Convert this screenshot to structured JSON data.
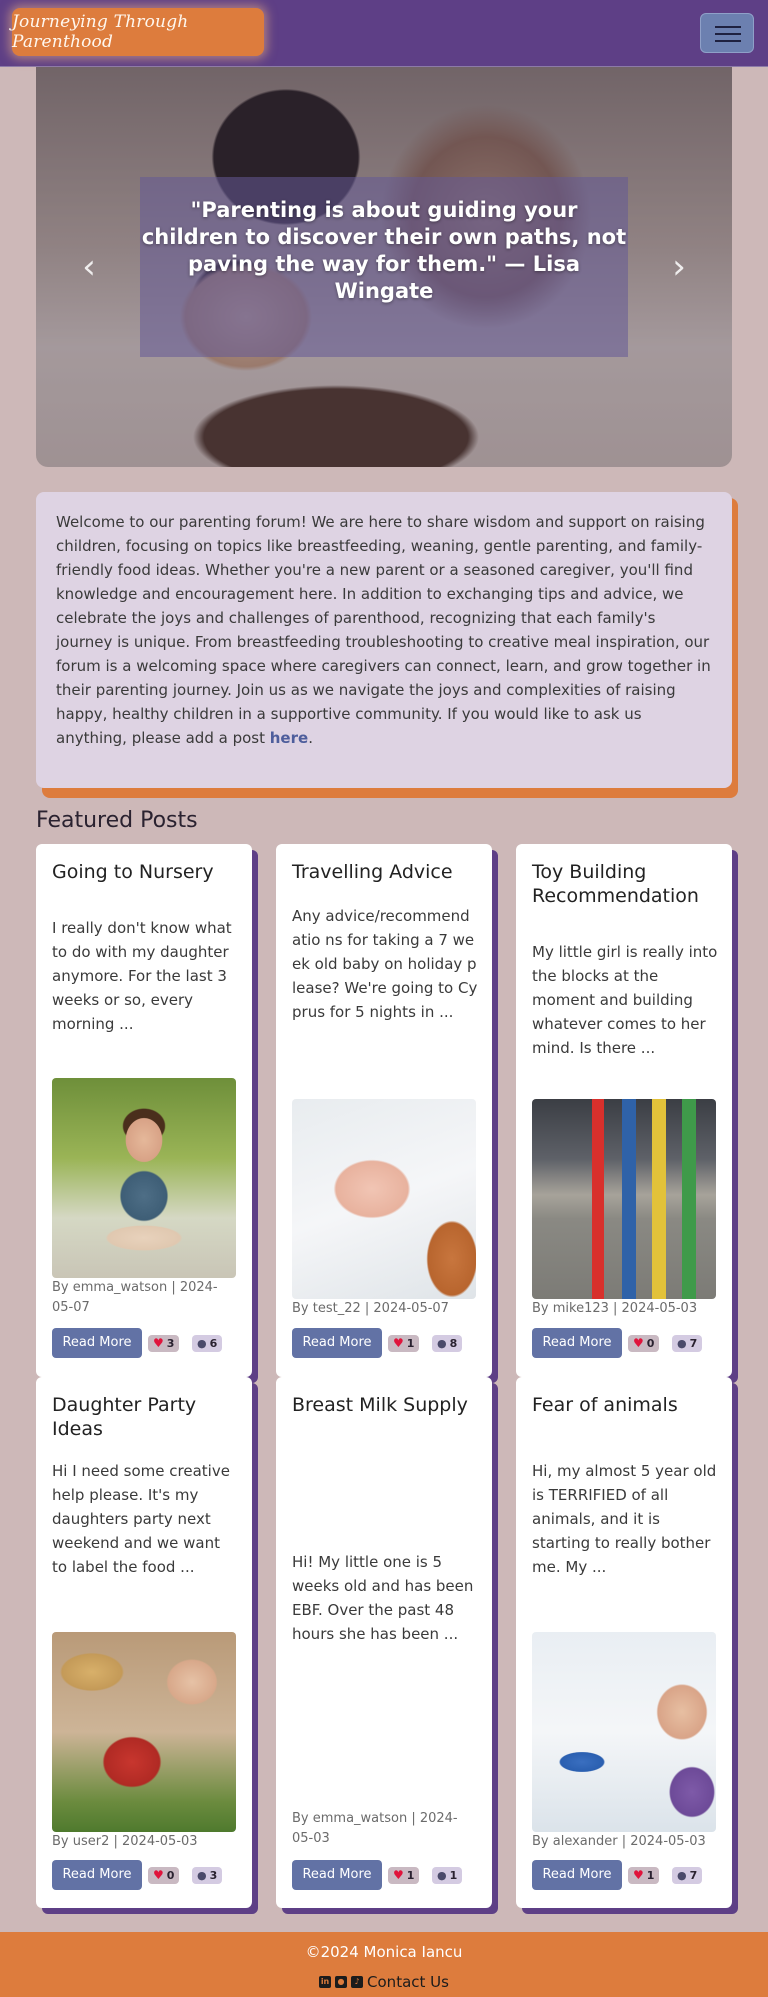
{
  "navbar": {
    "brand": "Journeying Through Parenthood",
    "toggler_icon": "hamburger-menu-icon"
  },
  "hero": {
    "quote": "\"Parenting is about guiding your children to discover their own paths, not paving the way for them.\" — Lisa Wingate",
    "prev_icon": "chevron-left-icon",
    "next_icon": "chevron-right-icon"
  },
  "welcome": {
    "text": "Welcome to our parenting forum! We are here to share wisdom and support on raising children, focusing on topics like breastfeeding, weaning, gentle parenting, and family-friendly food ideas. Whether you're a new parent or a seasoned caregiver, you'll find knowledge and encouragement here. In addition to exchanging tips and advice, we celebrate the joys and challenges of parenthood, recognizing that each family's journey is unique. From breastfeeding troubleshooting to creative meal inspiration, our forum is a welcoming space where caregivers can connect, learn, and grow together in their parenting journey. Join us as we navigate the joys and complexities of raising happy, healthy children in a supportive community. If you would like to ask us anything, please add a post ",
    "link_text": "here",
    "end": "."
  },
  "featured": {
    "title": "Featured Posts",
    "read_more_label": "Read More",
    "posts": [
      {
        "title": "Going to Nursery",
        "excerpt": "I really don't know what to do with my daughter anymore. For the last 3 weeks or so, every morning ...",
        "meta": "By emma_watson | 2024-05-07",
        "likes": "3",
        "comments": "6"
      },
      {
        "title": "Travelling Advice",
        "excerpt": "Any advice/recommendatio ns for taking a 7 week old baby on holiday please? We're going to Cyprus for 5 nights in ...",
        "meta": "By test_22 | 2024-05-07",
        "likes": "1",
        "comments": "8"
      },
      {
        "title": "Toy Building Recommendation",
        "excerpt": "My little girl is really into the blocks at the moment and building whatever comes to her mind. Is there ...",
        "meta": "By mike123 | 2024-05-03",
        "likes": "0",
        "comments": "7"
      },
      {
        "title": "Daughter Party Ideas",
        "excerpt": "Hi I need some creative help please. It's my daughters party next weekend and we want to label the food ...",
        "meta": "By user2 | 2024-05-03",
        "likes": "0",
        "comments": "3"
      },
      {
        "title": "Breast Milk Supply",
        "excerpt": "Hi! My little one is 5 weeks old and has been EBF. Over the past 48 hours she has been ...",
        "meta": "By emma_watson | 2024-05-03",
        "likes": "1",
        "comments": "1"
      },
      {
        "title": "Fear of animals",
        "excerpt": "Hi, my almost 5 year old is TERRIFIED of all animals, and it is starting to really bother me. My ...",
        "meta": "By alexander | 2024-05-03",
        "likes": "1",
        "comments": "7"
      }
    ]
  },
  "footer": {
    "copyright": "©2024 Monica Iancu",
    "contact": "Contact Us",
    "icons": [
      "linkedin-icon",
      "github-icon",
      "tiktok-icon"
    ]
  },
  "colors": {
    "navbar": "#5e3f86",
    "accent": "#dd7c3d",
    "button": "#6272a5",
    "background": "#cdb8b8"
  }
}
